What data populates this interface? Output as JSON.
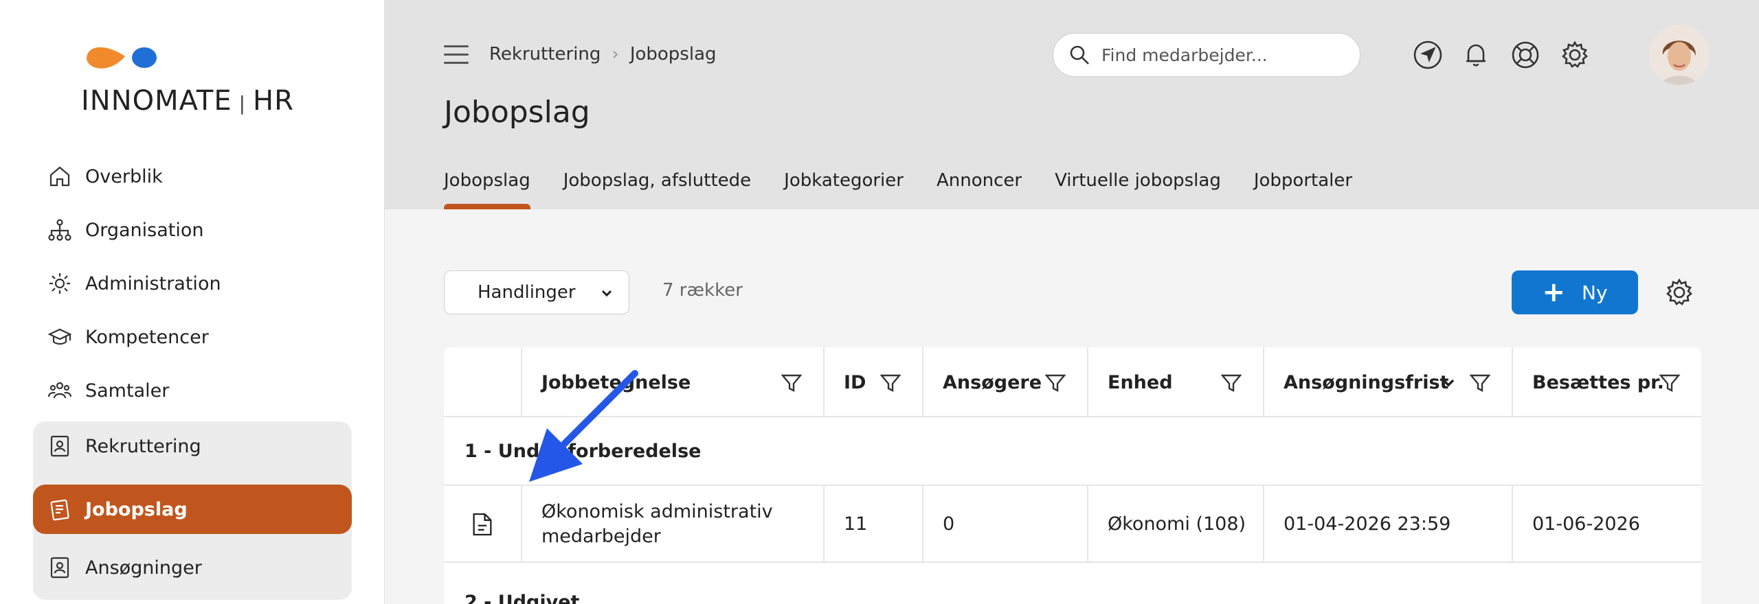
{
  "brand": {
    "name": "INNOMATE",
    "suffix": "HR",
    "logo_colors": [
      "#f08a2c",
      "#1f6fd6"
    ]
  },
  "sidebar": {
    "items": [
      {
        "label": "Overblik",
        "icon": "home-icon"
      },
      {
        "label": "Organisation",
        "icon": "org-chart-icon"
      },
      {
        "label": "Administration",
        "icon": "admin-gear-icon"
      },
      {
        "label": "Kompetencer",
        "icon": "graduation-cap-icon"
      },
      {
        "label": "Samtaler",
        "icon": "people-icon"
      }
    ],
    "group": {
      "label": "Rekruttering",
      "icon": "badge-icon",
      "children": [
        {
          "label": "Jobopslag",
          "icon": "job-post-icon",
          "active": true
        },
        {
          "label": "Ansøgninger",
          "icon": "badge-icon"
        }
      ]
    }
  },
  "header": {
    "breadcrumb": [
      "Rekruttering",
      "Jobopslag"
    ],
    "title": "Jobopslag",
    "search_placeholder": "Find medarbejder...",
    "icons": [
      "navigate-icon",
      "bell-icon",
      "help-lifebuoy-icon",
      "settings-icon"
    ],
    "tabs": [
      {
        "label": "Jobopslag",
        "active": true
      },
      {
        "label": "Jobopslag, afsluttede"
      },
      {
        "label": "Jobkategorier"
      },
      {
        "label": "Annoncer"
      },
      {
        "label": "Virtuelle jobopslag"
      },
      {
        "label": "Jobportaler"
      }
    ]
  },
  "toolbar": {
    "actions_label": "Handlinger",
    "rows_count": "7 rækker",
    "new_label": "Ny"
  },
  "table": {
    "columns": [
      "Jobbetegnelse",
      "ID",
      "Ansøgere",
      "Enhed",
      "Ansøgningsfrist",
      "Besættes pr."
    ],
    "groups": [
      {
        "label": "1 - Under forberedelse",
        "rows": [
          {
            "title_line1": "Økonomisk administrativ",
            "title_line2": "medarbejder",
            "id": "11",
            "applicants": "0",
            "unit": "Økonomi (108)",
            "deadline": "01-04-2026 23:59",
            "fill_by": "01-06-2026"
          }
        ]
      },
      {
        "label": "2 - Udgivet"
      }
    ]
  },
  "colors": {
    "accent": "#c0561e",
    "primary": "#1176d0",
    "annotation_arrow": "#2457e8"
  }
}
